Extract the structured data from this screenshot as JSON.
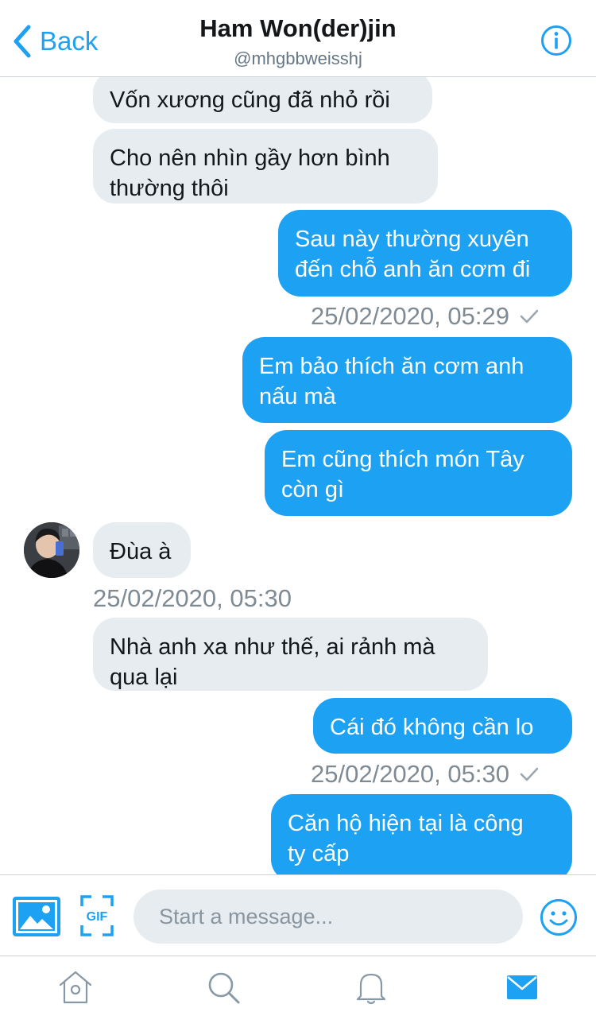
{
  "header": {
    "back_label": "Back",
    "title": "Ham Won(der)jin",
    "handle": "@mhgbbweisshj"
  },
  "messages": [
    {
      "side": "received",
      "text": "Vốn xương cũng đã nhỏ rồi"
    },
    {
      "side": "received",
      "text": "Cho nên nhìn gầy hơn bình\nthường thôi"
    },
    {
      "side": "sent",
      "text": "Sau này thường xuyên\nđến chỗ anh ăn cơm đi"
    },
    {
      "side": "sent",
      "text": "Em bảo thích ăn cơm anh\nnấu mà"
    },
    {
      "side": "sent",
      "text": "Em cũng thích món Tây\ncòn gì"
    },
    {
      "side": "received",
      "text": "Đùa à"
    },
    {
      "side": "received",
      "text": "Nhà anh xa như thế, ai rảnh mà\nqua lại"
    },
    {
      "side": "sent",
      "text": "Cái đó không cần lo"
    },
    {
      "side": "sent",
      "text": "Căn hộ hiện tại là công\nty cấp"
    }
  ],
  "timestamps": {
    "sent_1": "25/02/2020, 05:29",
    "received_1": "25/02/2020, 05:30",
    "sent_2": "25/02/2020, 05:30"
  },
  "composer": {
    "placeholder": "Start a message...",
    "gif_label": "GIF"
  },
  "tabs": [
    "home",
    "search",
    "notifications",
    "messages"
  ],
  "active_tab": "messages",
  "colors": {
    "accent": "#1da1f2",
    "received_bubble": "#e6ecf0",
    "muted_text": "#7f8b94",
    "inactive_icon": "#8899a6"
  }
}
